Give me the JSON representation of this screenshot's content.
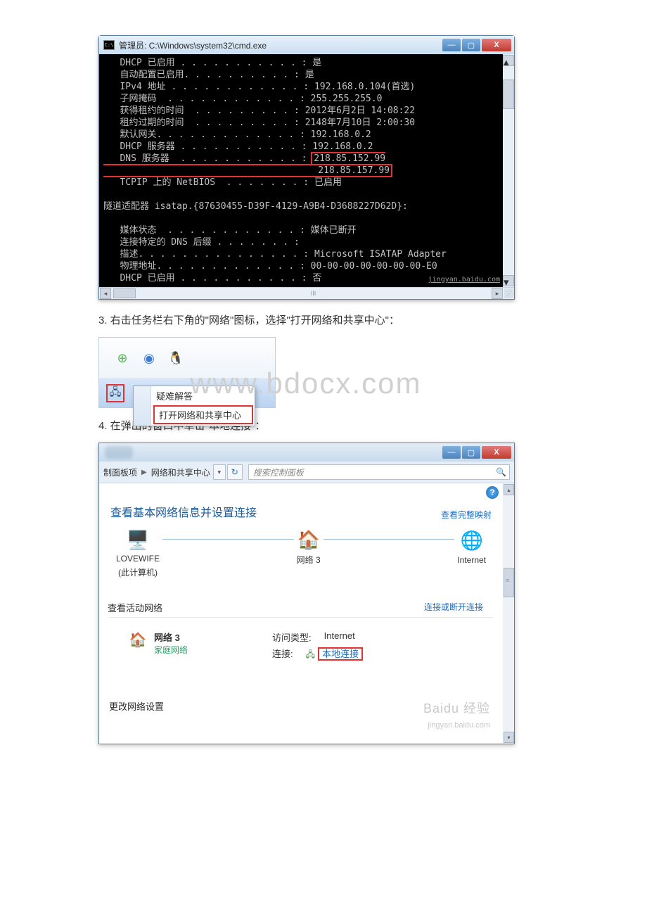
{
  "cmd": {
    "title": "管理员: C:\\Windows\\system32\\cmd.exe",
    "dhcp_enabled_label": "DHCP 已启用",
    "dhcp_enabled_val": "是",
    "auto_config_label": "自动配置已启用",
    "auto_config_val": "是",
    "ipv4_label": "IPv4 地址",
    "ipv4_val": "192.168.0.104(首选)",
    "mask_label": "子网掩码",
    "mask_val": "255.255.255.0",
    "lease_obt_label": "获得租约的时间",
    "lease_obt_val": "2012年6月2日 14:08:22",
    "lease_exp_label": "租约过期的时间",
    "lease_exp_val": "2148年7月10日 2:00:30",
    "gw_label": "默认网关",
    "gw_val": "192.168.0.2",
    "dhcp_srv_label": "DHCP 服务器",
    "dhcp_srv_val": "192.168.0.2",
    "dns_label": "DNS 服务器",
    "dns1": "218.85.152.99",
    "dns2": "218.85.157.99",
    "netbios_label": "TCPIP 上的 NetBIOS",
    "netbios_val": "已启用",
    "tunnel": "隧道适配器 isatap.{87630455-D39F-4129-A9B4-D3688227D62D}:",
    "media_label": "媒体状态",
    "media_val": "媒体已断开",
    "dns_suffix_label": "连接特定的 DNS 后缀",
    "desc_label": "描述",
    "desc_val": "Microsoft ISATAP Adapter",
    "phys_label": "物理地址",
    "phys_val": "00-00-00-00-00-00-00-E0",
    "dhcp2_label": "DHCP 已启用",
    "dhcp2_val": "否",
    "watermark_small": "jingyan.baidu.com"
  },
  "step3": "3. 右击任务栏右下角的\"网络\"图标，选择\"打开网络和共享中心\"：",
  "tray": {
    "menu1": "疑难解答",
    "menu2": "打开网络和共享中心",
    "watermark": "www.bdocx.com"
  },
  "step4": "4. 在弹出的窗口中单击\"本地连接\"：",
  "nc": {
    "crumb1": "制面板项",
    "crumb2": "网络和共享中心",
    "search_placeholder": "搜索控制面板",
    "h1": "查看基本网络信息并设置连接",
    "full_map": "查看完整映射",
    "node1": "LOVEWIFE",
    "node1_sub": "(此计算机)",
    "node2": "网络 3",
    "node3": "Internet",
    "active_title": "查看活动网络",
    "conn_link": "连接或断开连接",
    "net_name": "网络 3",
    "home_net": "家庭网络",
    "access_label": "访问类型:",
    "access_val": "Internet",
    "conn_label": "连接:",
    "conn_val": "本地连接",
    "change_title": "更改网络设置",
    "wm1": "Baidu 经验",
    "wm2": "jingyan.baidu.com"
  }
}
